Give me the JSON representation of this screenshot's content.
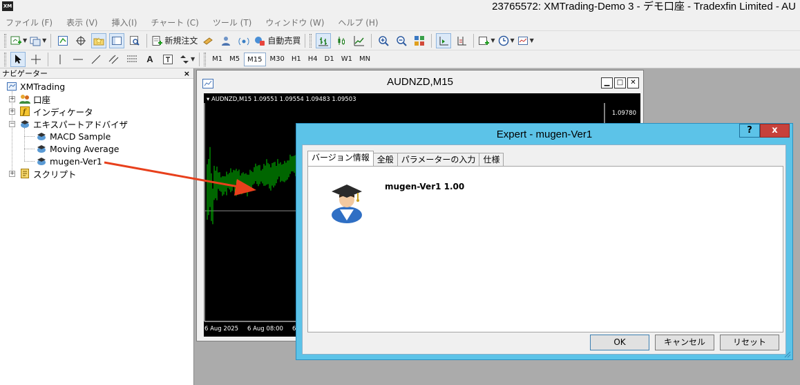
{
  "titlebar": {
    "logo": "XM",
    "title": "23765572: XMTrading-Demo 3 - デモ口座 - Tradexfin Limited - AU"
  },
  "menu": [
    {
      "label": "ファイル (F)"
    },
    {
      "label": "表示 (V)"
    },
    {
      "label": "挿入(I)"
    },
    {
      "label": "チャート (C)"
    },
    {
      "label": "ツール (T)"
    },
    {
      "label": "ウィンドウ (W)"
    },
    {
      "label": "ヘルプ (H)"
    }
  ],
  "toolbar": {
    "new_order_label": "新規注文",
    "auto_trading_label": "自動売買",
    "text_tool": "A",
    "timeframes": [
      "M1",
      "M5",
      "M15",
      "M30",
      "H1",
      "H4",
      "D1",
      "W1",
      "MN"
    ],
    "active_timeframe": "M15"
  },
  "navigator": {
    "title": "ナビゲーター",
    "close": "×",
    "root": "XMTrading",
    "items": [
      {
        "label": "口座"
      },
      {
        "label": "インディケータ"
      },
      {
        "label": "エキスパートアドバイザ"
      },
      {
        "label": "MACD Sample"
      },
      {
        "label": "Moving Average"
      },
      {
        "label": "mugen-Ver1"
      },
      {
        "label": "スクリプト"
      }
    ]
  },
  "chart_window": {
    "title": "AUDNZD,M15",
    "info": "AUDNZD,M15  1.09551 1.09554 1.09483 1.09503",
    "price_label": "1.09780",
    "dates": [
      "6 Aug 2025",
      "6 Aug 08:00",
      "6"
    ],
    "colors": {
      "background": "#000000",
      "candles": "#00cc00",
      "bid_line": "#8a8a8a"
    }
  },
  "dialog": {
    "title": "Expert - mugen-Ver1",
    "help": "?",
    "close": "x",
    "tabs": [
      {
        "label": "バージョン情報"
      },
      {
        "label": "全般"
      },
      {
        "label": "パラメーターの入力"
      },
      {
        "label": "仕様"
      }
    ],
    "expert_name": "mugen-Ver1 1.00",
    "ok": "OK",
    "cancel": "キャンセル",
    "reset": "リセット"
  },
  "annotation": {
    "color": "#e8401c",
    "icon": "arrow-icon"
  }
}
